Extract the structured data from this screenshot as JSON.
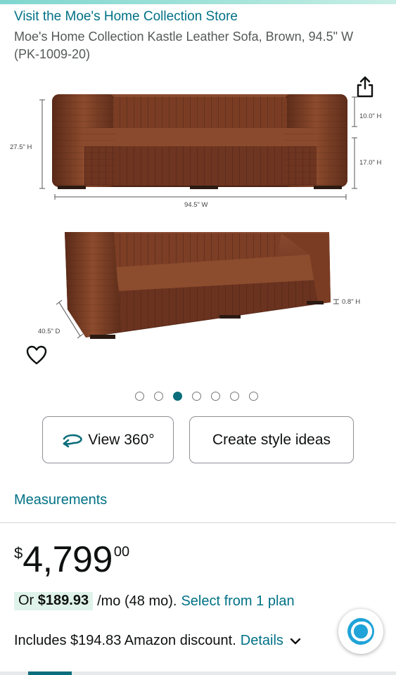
{
  "store": {
    "link_text": "Visit the Moe's Home Collection Store"
  },
  "product": {
    "title": "Moe's Home Collection Kastle Leather Sofa, Brown, 94.5\" W (PK-1009-20)"
  },
  "gallery": {
    "dimensions": {
      "height_total": "27.5\" H",
      "width": "94.5\" W",
      "arm_height": "10.0\" H",
      "seat_height": "17.0\" H",
      "leg_height": "0.8\" H",
      "depth": "40.5\" D"
    },
    "dot_count": 7,
    "active_dot": 3
  },
  "actions": {
    "view_360_label": "View 360°",
    "style_ideas_label": "Create style ideas"
  },
  "measurements": {
    "link_text": "Measurements"
  },
  "price": {
    "symbol": "$",
    "whole": "4,799",
    "fraction": "00"
  },
  "financing": {
    "or_text": "Or",
    "monthly_amount": "$189.93",
    "term_text": "/mo (48 mo).",
    "plan_link": "Select from 1 plan"
  },
  "discount": {
    "text": "Includes $194.83 Amazon discount.",
    "details_link": "Details"
  },
  "icons": {
    "share": "share-icon",
    "favorite": "heart-icon",
    "view_360": "rotate-360-icon",
    "chevron": "chevron-down-icon",
    "assistant": "alexa-icon"
  },
  "colors": {
    "link": "#007185",
    "accent": "#0a6d7b",
    "leather": "#6b3420",
    "badge_bg": "#dff3ea"
  }
}
